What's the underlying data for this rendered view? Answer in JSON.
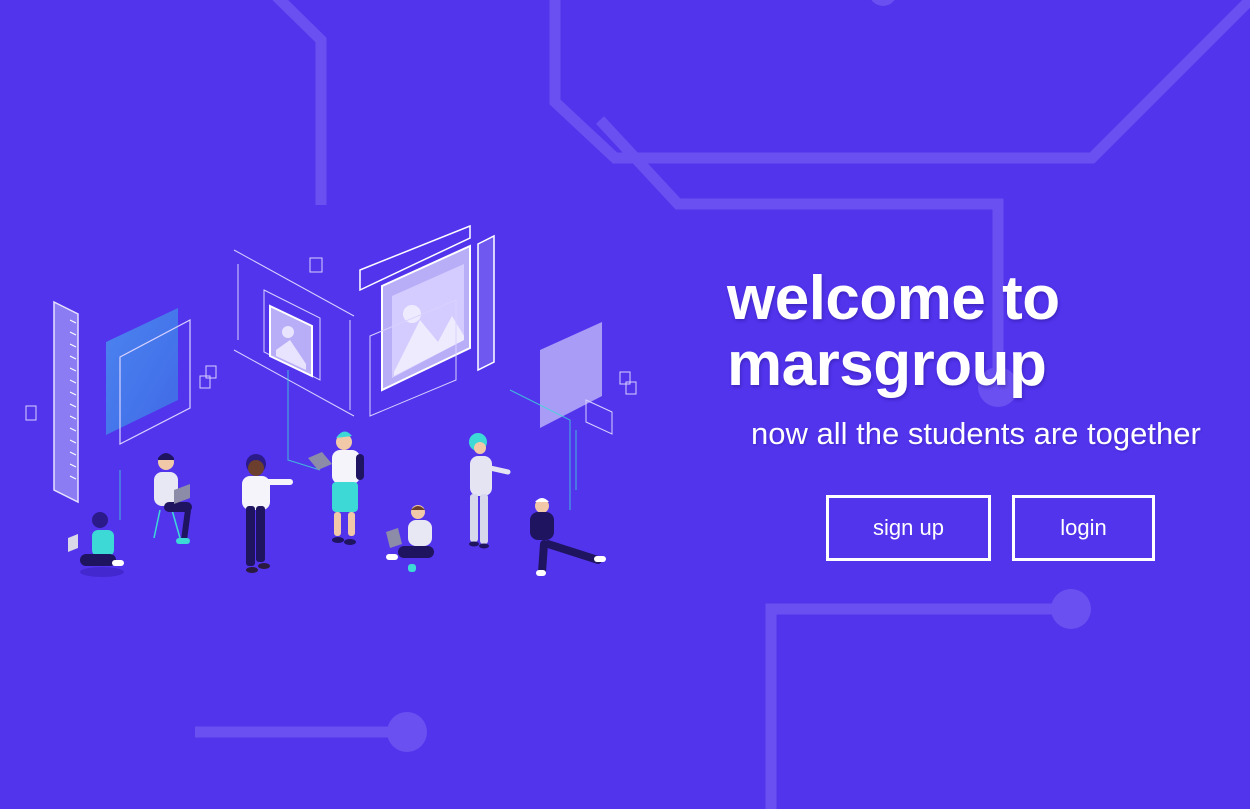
{
  "hero": {
    "title_line1": "welcome to",
    "title_line2": "marsgroup",
    "subtitle": "now all the students are together"
  },
  "actions": {
    "signup_label": "sign up",
    "login_label": "login"
  },
  "colors": {
    "background": "#5234ED",
    "circuit_lines": "#6A50F0",
    "text": "#FFFFFF",
    "accent_teal": "#3DD9D6"
  },
  "illustration": {
    "icon": "students-collaboration-illustration"
  }
}
